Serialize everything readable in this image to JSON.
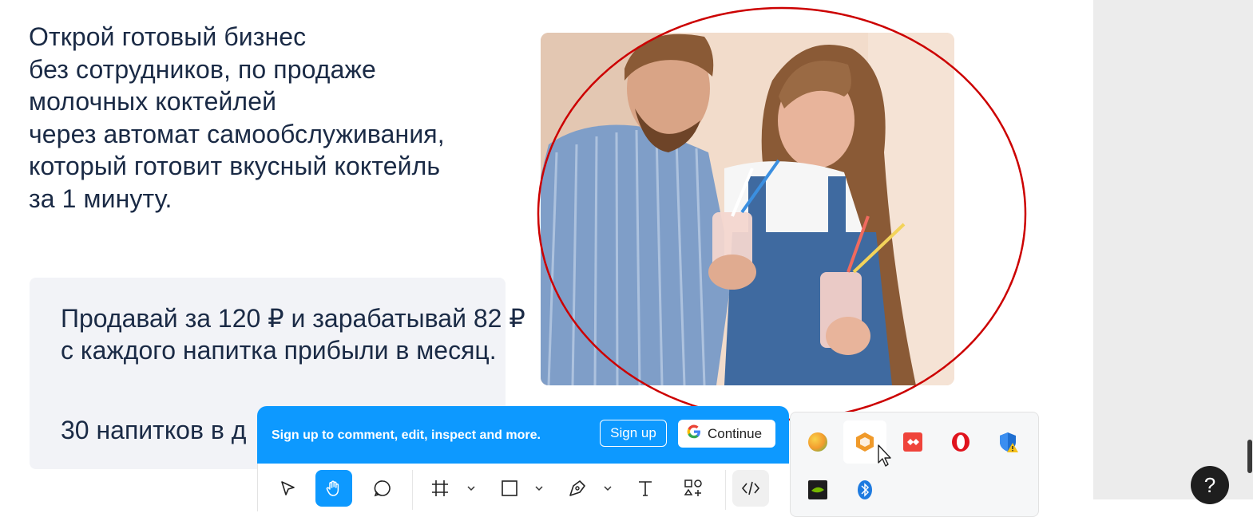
{
  "headline": {
    "lines": [
      "Открой готовый бизнес",
      "без сотрудников, по продаже",
      "молочных коктейлей",
      "через автомат самообслуживания,",
      "который  готовит  вкусный коктейль",
      "за 1 минуту."
    ]
  },
  "promo": {
    "line1": "Продавай за 120 ₽ и зарабатывай 82 ₽",
    "line2": "с каждого напитка прибыли в месяц.",
    "line3": "30 напитков в д"
  },
  "banner": {
    "text": "Sign up to comment, edit, inspect and more.",
    "signup_label": "Sign up",
    "continue_label": "Continue"
  },
  "toolbar": {
    "tools": [
      "move-tool",
      "hand-tool",
      "comment-tool",
      "frame-tool",
      "shape-tool",
      "pen-tool",
      "text-tool",
      "components-tool",
      "dev-mode-tool"
    ],
    "active_tool": "hand-tool"
  },
  "tray": {
    "icons": [
      "chrome-canary-icon",
      "sublime-icon",
      "anydesk-icon",
      "opera-icon",
      "defender-warning-icon",
      "nvidia-icon",
      "bluetooth-icon"
    ]
  },
  "help": {
    "label": "?"
  },
  "colors": {
    "heading": "#1a2a45",
    "banner_blue": "#0d99ff",
    "annotation_red": "#cc0000",
    "card_bg": "#f2f3f7"
  }
}
